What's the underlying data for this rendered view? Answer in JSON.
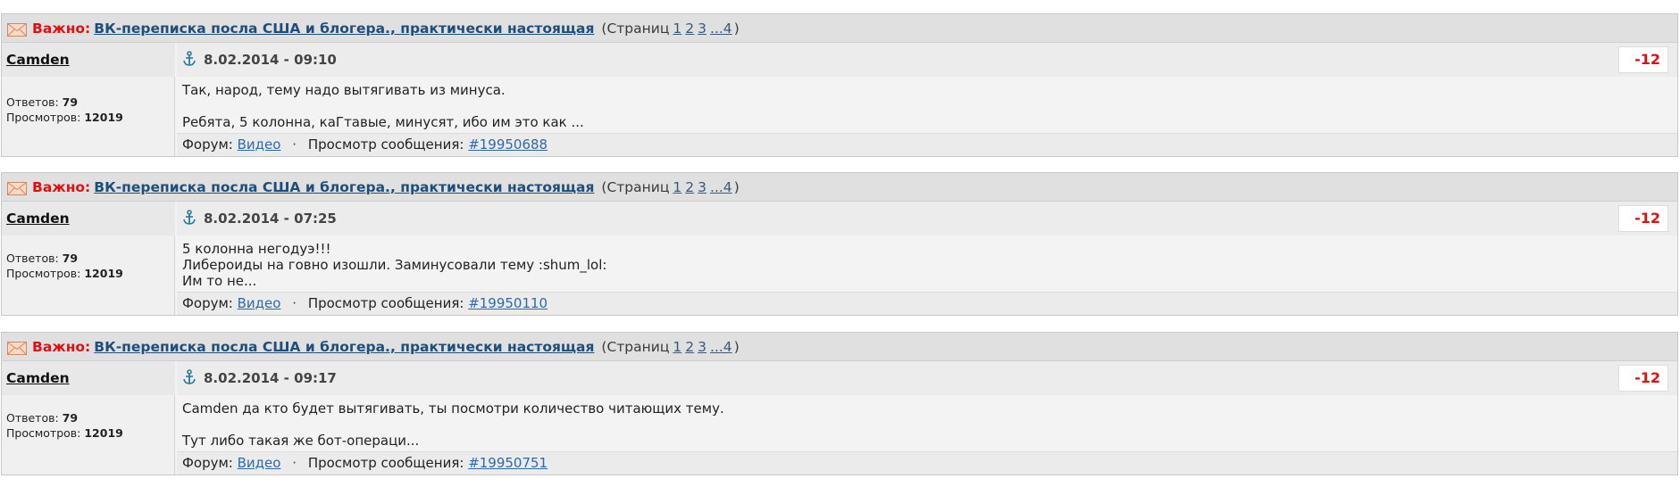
{
  "posts": [
    {
      "important_label": "Важно:",
      "topic_title": "ВК-переписка посла США и блогера., практически настоящая",
      "pages_open": "(Страниц",
      "page_links": [
        "1",
        "2",
        "3",
        "...4"
      ],
      "pages_close": ")",
      "author": "Camden",
      "replies_label": "Ответов:",
      "replies_value": "79",
      "views_label": "Просмотров:",
      "views_value": "12019",
      "date": "8.02.2014 - 09:10",
      "rating": "-12",
      "body_lines": [
        "Так, народ, тему надо вытягивать из минуса.",
        "",
        "Ребята, 5 колонна, каГтавые, минусят, ибо им это как ..."
      ],
      "forum_label": "Форум:",
      "forum_link": "Видео",
      "view_msg_label": "Просмотр сообщения:",
      "msg_link": "#19950688"
    },
    {
      "important_label": "Важно:",
      "topic_title": "ВК-переписка посла США и блогера., практически настоящая",
      "pages_open": "(Страниц",
      "page_links": [
        "1",
        "2",
        "3",
        "...4"
      ],
      "pages_close": ")",
      "author": "Camden",
      "replies_label": "Ответов:",
      "replies_value": "79",
      "views_label": "Просмотров:",
      "views_value": "12019",
      "date": "8.02.2014 - 07:25",
      "rating": "-12",
      "body_lines": [
        "5 колонна негодуэ!!!",
        "Либероиды на говно изошли. Заминусовали тему :shum_lol:",
        "Им то не..."
      ],
      "forum_label": "Форум:",
      "forum_link": "Видео",
      "view_msg_label": "Просмотр сообщения:",
      "msg_link": "#19950110"
    },
    {
      "important_label": "Важно:",
      "topic_title": "ВК-переписка посла США и блогера., практически настоящая",
      "pages_open": "(Страниц",
      "page_links": [
        "1",
        "2",
        "3",
        "...4"
      ],
      "pages_close": ")",
      "author": "Camden",
      "replies_label": "Ответов:",
      "replies_value": "79",
      "views_label": "Просмотров:",
      "views_value": "12019",
      "date": "8.02.2014 - 09:17",
      "rating": "-12",
      "body_lines": [
        "Camden да кто будет вытягивать, ты посмотри количество читающих тему.",
        "",
        "Тут либо такая же бот-операци..."
      ],
      "forum_label": "Форум:",
      "forum_link": "Видео",
      "view_msg_label": "Просмотр сообщения:",
      "msg_link": "#19950751"
    }
  ],
  "icons": {
    "topic": "envelope-icon",
    "post_link": "anchor-icon"
  },
  "colors": {
    "important": "#e01010",
    "topic_link": "#1f4e7a",
    "link": "#2e6aa8",
    "rating": "#e01010"
  }
}
